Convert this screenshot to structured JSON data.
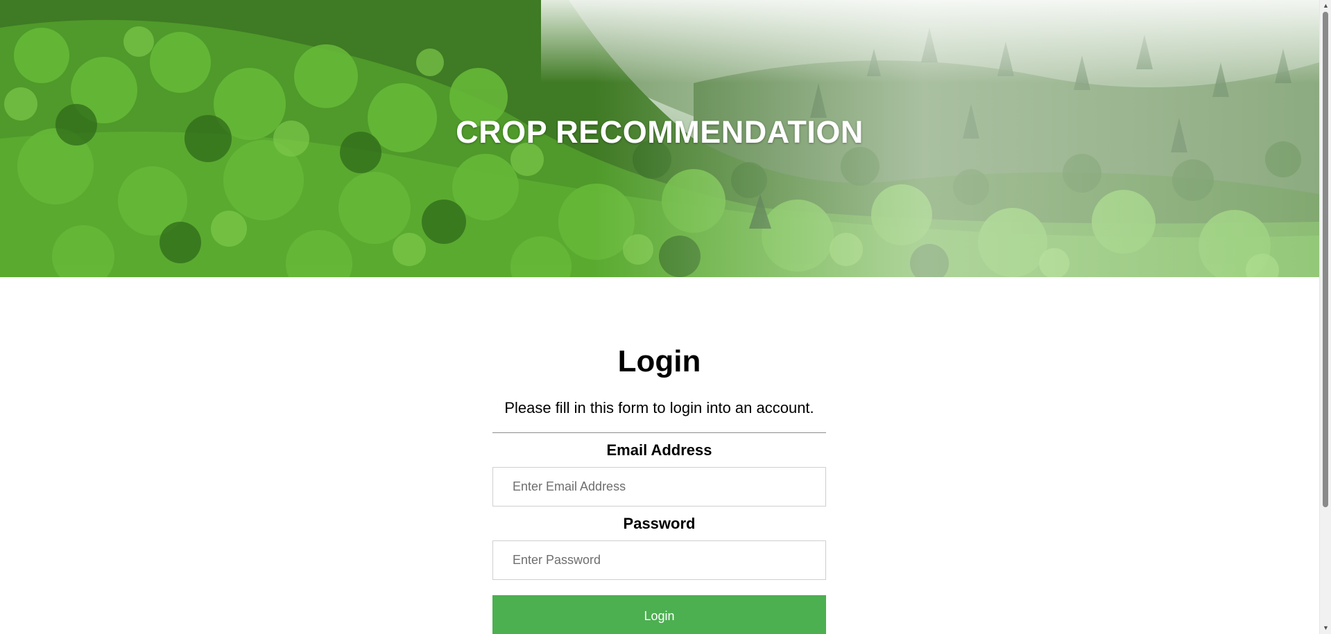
{
  "hero": {
    "title": "CROP RECOMMENDATION",
    "image": "forest-background"
  },
  "login_form": {
    "heading": "Login",
    "subtitle": "Please fill in this form to login into an account.",
    "email_label": "Email Address",
    "email_placeholder": "Enter Email Address",
    "email_value": "",
    "password_label": "Password",
    "password_placeholder": "Enter Password",
    "password_value": "",
    "submit_label": "Login"
  },
  "colors": {
    "button_green": "#4caf50",
    "hero_title_text": "#ffffff"
  },
  "scrollbar": {
    "up_icon": "triangle-up-icon",
    "down_icon": "triangle-down-icon"
  }
}
